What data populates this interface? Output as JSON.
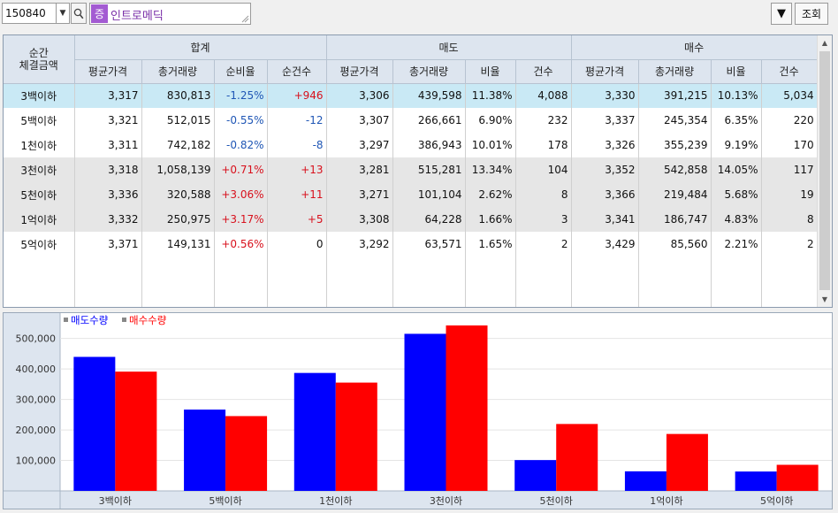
{
  "toolbar": {
    "code": "150840",
    "badge": "증",
    "name": "인트로메딕",
    "query_label": "조회"
  },
  "grid": {
    "corner_label": [
      "순간",
      "체결금액"
    ],
    "groups": [
      "합계",
      "매도",
      "매수"
    ],
    "columns": {
      "sum": [
        "평균가격",
        "총거래량",
        "순비율",
        "순건수"
      ],
      "sell": [
        "평균가격",
        "총거래량",
        "비율",
        "건수"
      ],
      "buy": [
        "평균가격",
        "총거래량",
        "비율",
        "건수"
      ]
    },
    "rows": [
      {
        "cat": "3백이하",
        "sum_avg": "3,317",
        "sum_vol": "830,813",
        "net_ratio": "-1.25%",
        "net_count": "+946",
        "sell_avg": "3,306",
        "sell_vol": "439,598",
        "sell_ratio": "11.38%",
        "sell_count": "4,088",
        "buy_avg": "3,330",
        "buy_vol": "391,215",
        "buy_ratio": "10.13%",
        "buy_count": "5,034"
      },
      {
        "cat": "5백이하",
        "sum_avg": "3,321",
        "sum_vol": "512,015",
        "net_ratio": "-0.55%",
        "net_count": "-12",
        "sell_avg": "3,307",
        "sell_vol": "266,661",
        "sell_ratio": "6.90%",
        "sell_count": "232",
        "buy_avg": "3,337",
        "buy_vol": "245,354",
        "buy_ratio": "6.35%",
        "buy_count": "220"
      },
      {
        "cat": "1천이하",
        "sum_avg": "3,311",
        "sum_vol": "742,182",
        "net_ratio": "-0.82%",
        "net_count": "-8",
        "sell_avg": "3,297",
        "sell_vol": "386,943",
        "sell_ratio": "10.01%",
        "sell_count": "178",
        "buy_avg": "3,326",
        "buy_vol": "355,239",
        "buy_ratio": "9.19%",
        "buy_count": "170"
      },
      {
        "cat": "3천이하",
        "sum_avg": "3,318",
        "sum_vol": "1,058,139",
        "net_ratio": "+0.71%",
        "net_count": "+13",
        "sell_avg": "3,281",
        "sell_vol": "515,281",
        "sell_ratio": "13.34%",
        "sell_count": "104",
        "buy_avg": "3,352",
        "buy_vol": "542,858",
        "buy_ratio": "14.05%",
        "buy_count": "117"
      },
      {
        "cat": "5천이하",
        "sum_avg": "3,336",
        "sum_vol": "320,588",
        "net_ratio": "+3.06%",
        "net_count": "+11",
        "sell_avg": "3,271",
        "sell_vol": "101,104",
        "sell_ratio": "2.62%",
        "sell_count": "8",
        "buy_avg": "3,366",
        "buy_vol": "219,484",
        "buy_ratio": "5.68%",
        "buy_count": "19"
      },
      {
        "cat": "1억이하",
        "sum_avg": "3,332",
        "sum_vol": "250,975",
        "net_ratio": "+3.17%",
        "net_count": "+5",
        "sell_avg": "3,308",
        "sell_vol": "64,228",
        "sell_ratio": "1.66%",
        "sell_count": "3",
        "buy_avg": "3,341",
        "buy_vol": "186,747",
        "buy_ratio": "4.83%",
        "buy_count": "8"
      },
      {
        "cat": "5억이하",
        "sum_avg": "3,371",
        "sum_vol": "149,131",
        "net_ratio": "+0.56%",
        "net_count": "0",
        "sell_avg": "3,292",
        "sell_vol": "63,571",
        "sell_ratio": "1.65%",
        "sell_count": "2",
        "buy_avg": "3,429",
        "buy_vol": "85,560",
        "buy_ratio": "2.21%",
        "buy_count": "2"
      }
    ]
  },
  "colors": {
    "sell": "#0000ff",
    "buy": "#ff0000",
    "negative": "#1f56b5",
    "positive": "#d8101c",
    "selected_row": "#c9e9f5",
    "shaded_row": "#e6e6e6"
  },
  "chart_data": {
    "type": "bar",
    "categories": [
      "3백이하",
      "5백이하",
      "1천이하",
      "3천이하",
      "5천이하",
      "1억이하",
      "5억이하"
    ],
    "series": [
      {
        "name": "매도수량",
        "values": [
          439598,
          266661,
          386943,
          515281,
          101104,
          64228,
          63571
        ]
      },
      {
        "name": "매수수량",
        "values": [
          391215,
          245354,
          355239,
          542858,
          219484,
          186747,
          85560
        ]
      }
    ],
    "yticks": [
      "100,000",
      "200,000",
      "300,000",
      "400,000",
      "500,000"
    ],
    "ylim": [
      0,
      560000
    ],
    "grid": true,
    "legend": "top-left"
  }
}
